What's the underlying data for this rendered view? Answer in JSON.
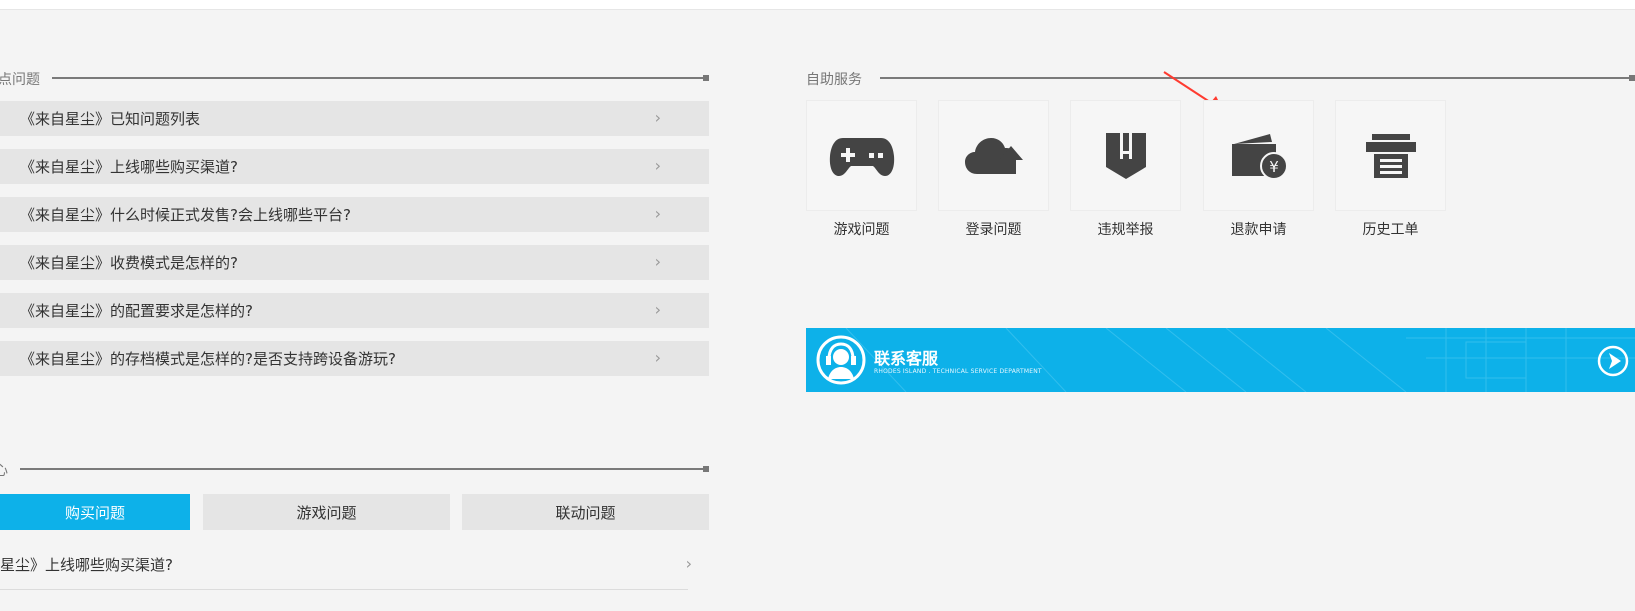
{
  "hot_section": {
    "title": "点问题",
    "items": [
      {
        "label": "《来自星尘》已知问题列表"
      },
      {
        "label": "《来自星尘》上线哪些购买渠道?"
      },
      {
        "label": "《来自星尘》什么时候正式发售?会上线哪些平台?"
      },
      {
        "label": "《来自星尘》收费模式是怎样的?"
      },
      {
        "label": "《来自星尘》的配置要求是怎样的?"
      },
      {
        "label": "《来自星尘》的存档模式是怎样的?是否支持跨设备游玩?"
      }
    ],
    "chevron": "›"
  },
  "self_service": {
    "title": "自助服务",
    "tiles": [
      {
        "label": "游戏问题",
        "icon": "gamepad-icon"
      },
      {
        "label": "登录问题",
        "icon": "cloud-upload-icon"
      },
      {
        "label": "违规举报",
        "icon": "shield-report-icon"
      },
      {
        "label": "退款申请",
        "icon": "wallet-yen-icon"
      },
      {
        "label": "历史工单",
        "icon": "printer-icon"
      }
    ]
  },
  "contact_banner": {
    "title": "联系客服",
    "subtitle": "RHODES ISLAND . TECHNICAL SERVICE DEPARTMENT",
    "icon": "headset-icon",
    "arrow_icon": "arrow-right-circle-icon"
  },
  "category_section": {
    "title": "心",
    "tabs": [
      {
        "label": "购买问题",
        "active": true
      },
      {
        "label": "游戏问题",
        "active": false
      },
      {
        "label": "联动问题",
        "active": false
      }
    ],
    "rows": [
      {
        "label": "星尘》上线哪些购买渠道?"
      }
    ]
  },
  "colors": {
    "accent": "#0db1e9",
    "row_bg": "#e5e5e5",
    "page_bg": "#f4f4f4",
    "annotation_arrow": "#ff3b30"
  }
}
